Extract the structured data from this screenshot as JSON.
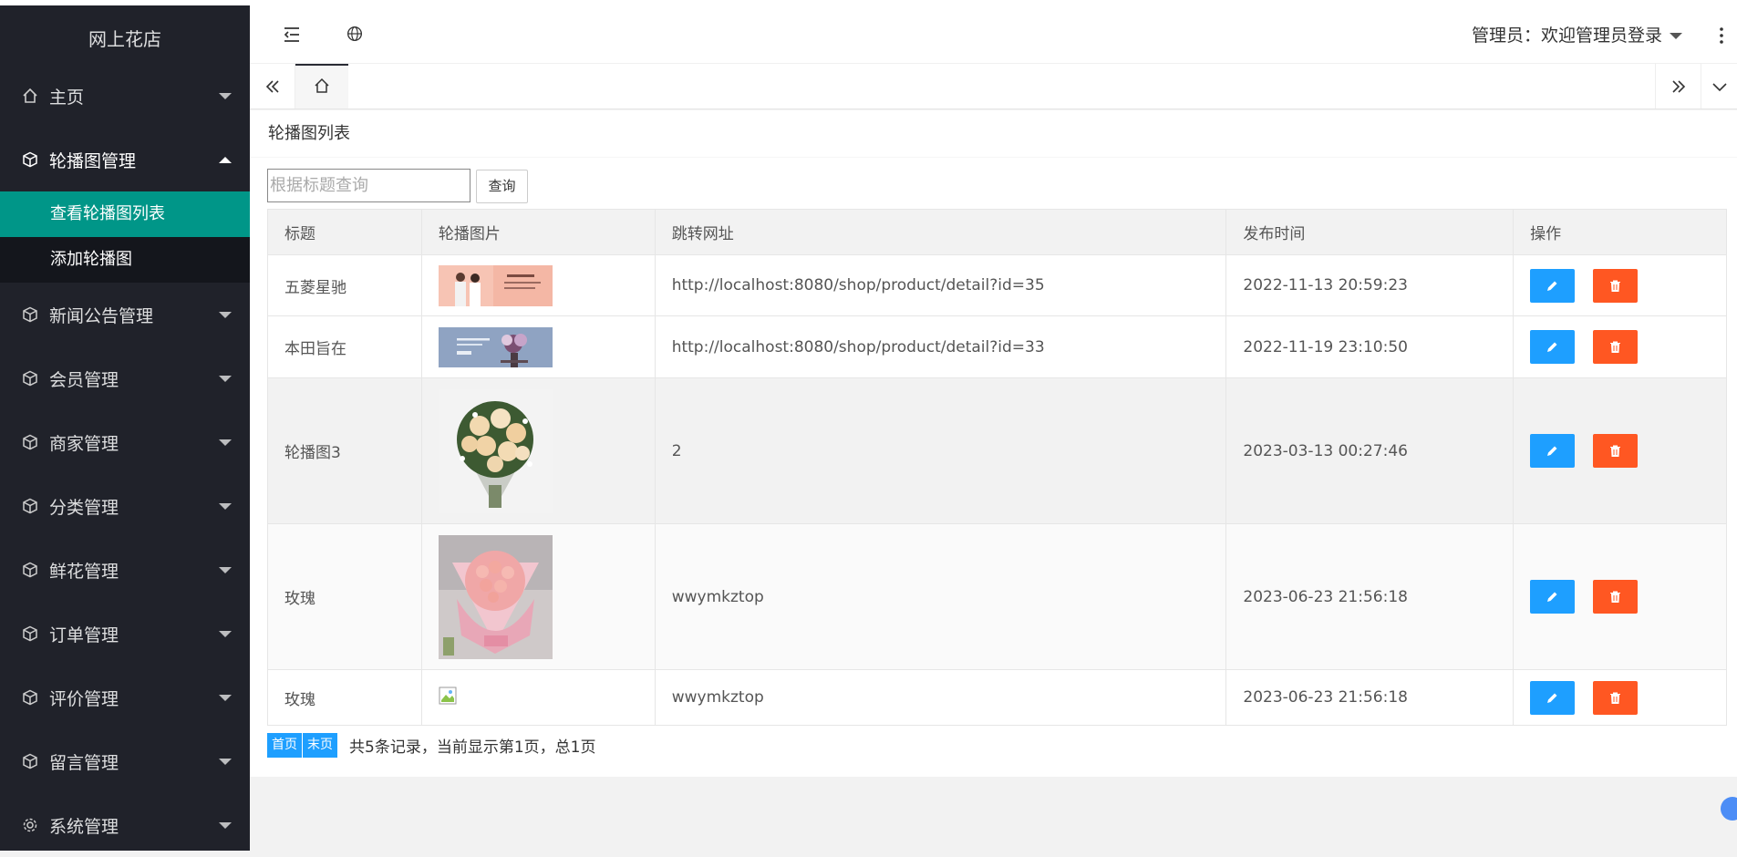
{
  "app": {
    "title": "网上花店"
  },
  "sidebar": {
    "items": [
      {
        "label": "主页",
        "icon": "home-icon"
      },
      {
        "label": "轮播图管理",
        "icon": "cube-icon",
        "open": true,
        "children": [
          {
            "label": "查看轮播图列表",
            "active": true
          },
          {
            "label": "添加轮播图"
          }
        ]
      },
      {
        "label": "新闻公告管理",
        "icon": "cube-icon"
      },
      {
        "label": "会员管理",
        "icon": "cube-icon"
      },
      {
        "label": "商家管理",
        "icon": "cube-icon"
      },
      {
        "label": "分类管理",
        "icon": "cube-icon"
      },
      {
        "label": "鲜花管理",
        "icon": "cube-icon"
      },
      {
        "label": "订单管理",
        "icon": "cube-icon"
      },
      {
        "label": "评价管理",
        "icon": "cube-icon"
      },
      {
        "label": "留言管理",
        "icon": "cube-icon"
      },
      {
        "label": "系统管理",
        "icon": "gear-icon"
      }
    ]
  },
  "header": {
    "user": "管理员：欢迎管理员登录"
  },
  "page": {
    "title": "轮播图列表",
    "search": {
      "placeholder": "根据标题查询",
      "button": "查询"
    },
    "table": {
      "columns": [
        "标题",
        "轮播图片",
        "跳转网址",
        "发布时间",
        "操作"
      ],
      "rows": [
        {
          "title": "五菱星驰",
          "image": "banner-couple-pink",
          "url": "http://localhost:8080/shop/product/detail?id=35",
          "time": "2022-11-13 20:59:23"
        },
        {
          "title": "本田旨在",
          "image": "banner-flowers-blue",
          "url": "http://localhost:8080/shop/product/detail?id=33",
          "time": "2022-11-19 23:10:50"
        },
        {
          "title": "轮播图3",
          "image": "bouquet-champagne-roses",
          "url": "2",
          "time": "2023-03-13 00:27:46"
        },
        {
          "title": "玫瑰",
          "image": "bouquet-pink-roses",
          "url": "wwymkztop",
          "time": "2023-06-23 21:56:18"
        },
        {
          "title": "玫瑰",
          "image": "broken-image",
          "url": "wwymkztop",
          "time": "2023-06-23 21:56:18"
        }
      ]
    },
    "pager": {
      "first": "首页",
      "last": "末页",
      "info": "共5条记录，当前显示第1页，总1页"
    }
  },
  "colors": {
    "sidebar": "#20222a",
    "active": "#009688",
    "edit": "#1e9fff",
    "delete": "#ff5722"
  }
}
